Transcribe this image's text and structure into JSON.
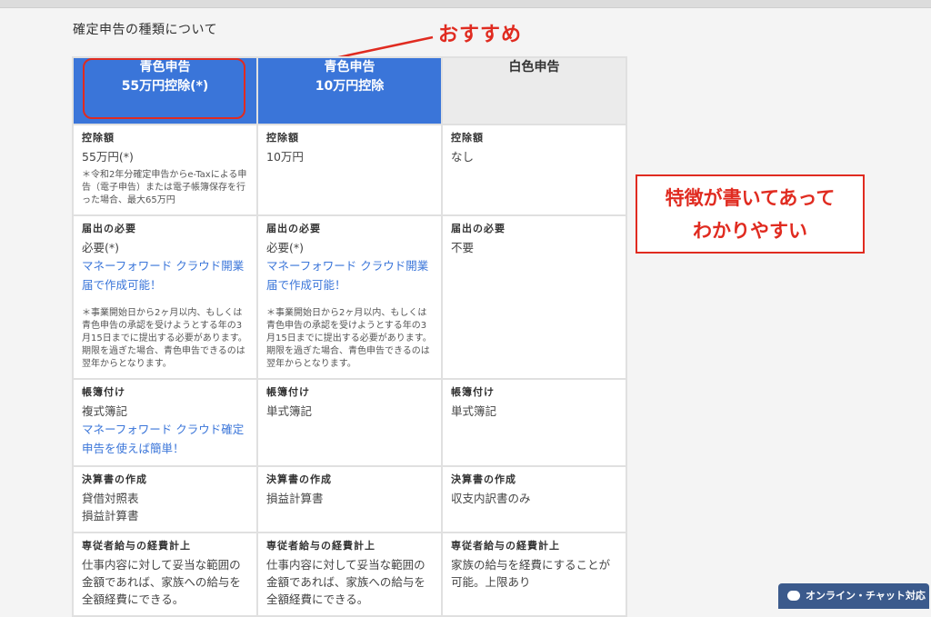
{
  "page": {
    "title": "確定申告の種類について"
  },
  "annotations": {
    "recommend": "おすすめ",
    "callout_line1": "特徴が書いてあって",
    "callout_line2": "わかりやすい"
  },
  "colors": {
    "header_blue": "#3a75d9",
    "header_gray": "#ebebeb",
    "annotation_red": "#e02b20",
    "link_blue": "#3a75d9",
    "chat_bg": "#3b5a8c"
  },
  "columns": [
    {
      "line1": "青色申告",
      "line2": "55万円控除(*)"
    },
    {
      "line1": "青色申告",
      "line2": "10万円控除"
    },
    {
      "line1": "白色申告",
      "line2": ""
    }
  ],
  "rows": {
    "deduction": {
      "label": "控除額",
      "cells": [
        {
          "value": "55万円(*)",
          "note": "＊令和2年分確定申告からe-Taxによる申告（電子申告）または電子帳簿保存を行った場合、最大65万円"
        },
        {
          "value": "10万円"
        },
        {
          "value": "なし"
        }
      ]
    },
    "filing": {
      "label": "届出の必要",
      "cells": [
        {
          "value": "必要(*)",
          "link": "マネーフォワード クラウド開業届で作成可能！",
          "note": "＊事業開始日から2ヶ月以内、もしくは青色申告の承認を受けようとする年の3月15日までに提出する必要があります。期限を過ぎた場合、青色申告できるのは翌年からとなります。"
        },
        {
          "value": "必要(*)",
          "link": "マネーフォワード クラウド開業届で作成可能！",
          "note": "＊事業開始日から2ヶ月以内、もしくは青色申告の承認を受けようとする年の3月15日までに提出する必要があります。期限を過ぎた場合、青色申告できるのは翌年からとなります。"
        },
        {
          "value": "不要"
        }
      ]
    },
    "bookkeeping": {
      "label": "帳簿付け",
      "cells": [
        {
          "value": "複式簿記",
          "link": "マネーフォワード クラウド確定申告を使えば簡単！"
        },
        {
          "value": "単式簿記"
        },
        {
          "value": "単式簿記"
        }
      ]
    },
    "statements": {
      "label": "決算書の作成",
      "cells": [
        {
          "value1": "貸借対照表",
          "value2": "損益計算書"
        },
        {
          "value1": "損益計算書"
        },
        {
          "value1": "収支内訳書のみ"
        }
      ]
    },
    "family_salary": {
      "label": "専従者給与の経費計上",
      "cells": [
        {
          "value": "仕事内容に対して妥当な範囲の金額であれば、家族への給与を全額経費にできる。"
        },
        {
          "value": "仕事内容に対して妥当な範囲の金額であれば、家族への給与を全額経費にできる。"
        },
        {
          "value": "家族の給与を経費にすることが可能。上限あり"
        }
      ]
    }
  },
  "chat": {
    "label": "オンライン・チャット対応",
    "icon": "chat-bubble-icon"
  }
}
